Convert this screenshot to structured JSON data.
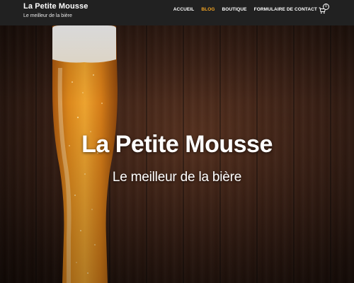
{
  "site": {
    "title": "La Petite Mousse",
    "tagline": "Le meilleur de la bière"
  },
  "nav": {
    "items": [
      {
        "label": "ACCUEIL",
        "active": false
      },
      {
        "label": "BLOG",
        "active": true
      },
      {
        "label": "BOUTIQUE",
        "active": false
      },
      {
        "label": "FORMULAIRE DE CONTACT",
        "active": false
      }
    ],
    "cart": {
      "icon": "shopping-cart-icon",
      "count": "0"
    }
  },
  "hero": {
    "title": "La Petite Mousse",
    "subtitle": "Le meilleur de la bière",
    "image": "beer-glass-on-wood"
  },
  "colors": {
    "header_bg": "#212121",
    "active_nav": "#f5a623",
    "text": "#ffffff"
  }
}
